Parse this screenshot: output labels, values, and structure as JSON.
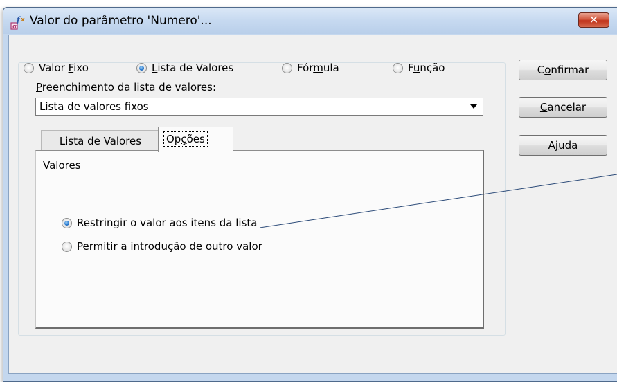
{
  "window": {
    "title": "Valor do parâmetro 'Numero'...",
    "close_label": "✕"
  },
  "value_type": {
    "options": [
      {
        "pre": "Valor ",
        "mn": "F",
        "post": "ixo",
        "selected": false
      },
      {
        "pre": "",
        "mn": "L",
        "post": "ista de Valores",
        "selected": true
      },
      {
        "pre": "Fór",
        "mn": "m",
        "post": "ula",
        "selected": false
      },
      {
        "pre": "F",
        "mn": "u",
        "post": "nção",
        "selected": false
      }
    ]
  },
  "buttons": {
    "confirm": {
      "pre": "C",
      "mn": "o",
      "post": "nfirmar"
    },
    "cancel": {
      "pre": "",
      "mn": "C",
      "post": "ancelar"
    },
    "help": {
      "pre": "A",
      "mn": "j",
      "post": "uda"
    }
  },
  "fill": {
    "label": {
      "pre": "",
      "mn": "P",
      "post": "reenchimento da lista de valores:"
    },
    "value": "Lista de valores fixos"
  },
  "tabs": {
    "list_values": "Lista de Valores",
    "options": {
      "pre": "Op",
      "mn": "ç",
      "post": "ões"
    }
  },
  "options_panel": {
    "group_label": "Valores",
    "radios": [
      {
        "label": "Restringir o valor aos itens da lista",
        "selected": true
      },
      {
        "label": "Permitir a introdução de outro valor",
        "selected": false
      }
    ]
  },
  "colors": {
    "title_bar": "#c6d9f0",
    "client_bg": "#f0f0f0",
    "close_button": "#c0321a",
    "radio_selected": "#2b7bd0"
  }
}
